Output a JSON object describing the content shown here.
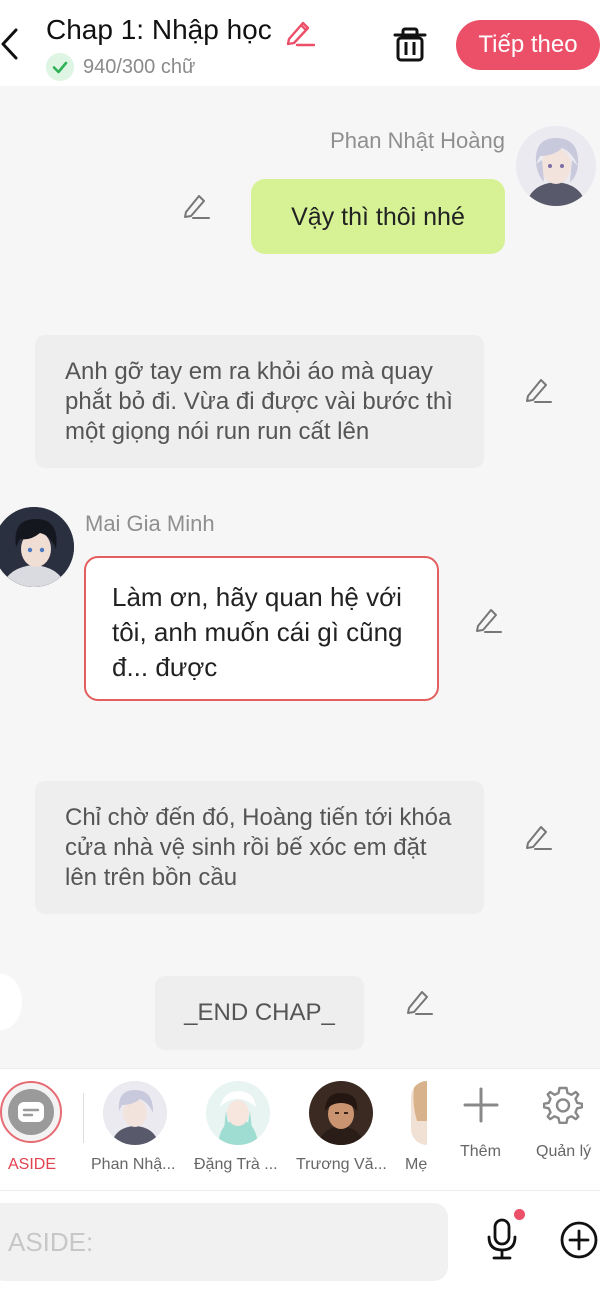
{
  "header": {
    "title": "Chap 1: Nhập học",
    "word_count": "940/300 chữ",
    "next_label": "Tiếp theo",
    "accent": "#ec4f68"
  },
  "messages": [
    {
      "type": "character",
      "side": "right",
      "sender": "Phan Nhật Hoàng",
      "text": "Vậy thì thôi nhé",
      "bubble_color": "#d6f295"
    },
    {
      "type": "narration",
      "text": "Anh gỡ tay em ra khỏi áo mà quay phắt bỏ đi. Vừa đi được vài bước thì một giọng nói run run cất lên"
    },
    {
      "type": "character",
      "side": "left",
      "sender": "Mai Gia Minh",
      "text": "Làm ơn, hãy quan hệ với tôi, anh muốn cái gì cũng đ... được",
      "border_color": "#e35f5f"
    },
    {
      "type": "narration",
      "text": "Chỉ chờ đến đó, Hoàng tiến tới khóa cửa nhà vệ sinh rồi bế xóc em đặt lên trên bồn cầu"
    },
    {
      "type": "narration",
      "text": "_END CHAP_"
    }
  ],
  "characters": {
    "aside": {
      "label": "ASIDE"
    },
    "list": [
      {
        "label": "Phan Nhậ..."
      },
      {
        "label": "Đặng Trà ..."
      },
      {
        "label": "Trương Vă..."
      },
      {
        "label": "Mẹ"
      }
    ],
    "add_label": "Thêm",
    "manage_label": "Quản lý"
  },
  "input": {
    "placeholder": "ASIDE:",
    "value": ""
  },
  "icons": {
    "back": "chevron-left-icon",
    "title_edit": "pencil-icon",
    "status": "check-circle-icon",
    "delete": "trash-icon",
    "edit": "pencil-icon",
    "mic": "microphone-icon",
    "add": "plus-circle-icon",
    "settings": "gear-icon"
  }
}
